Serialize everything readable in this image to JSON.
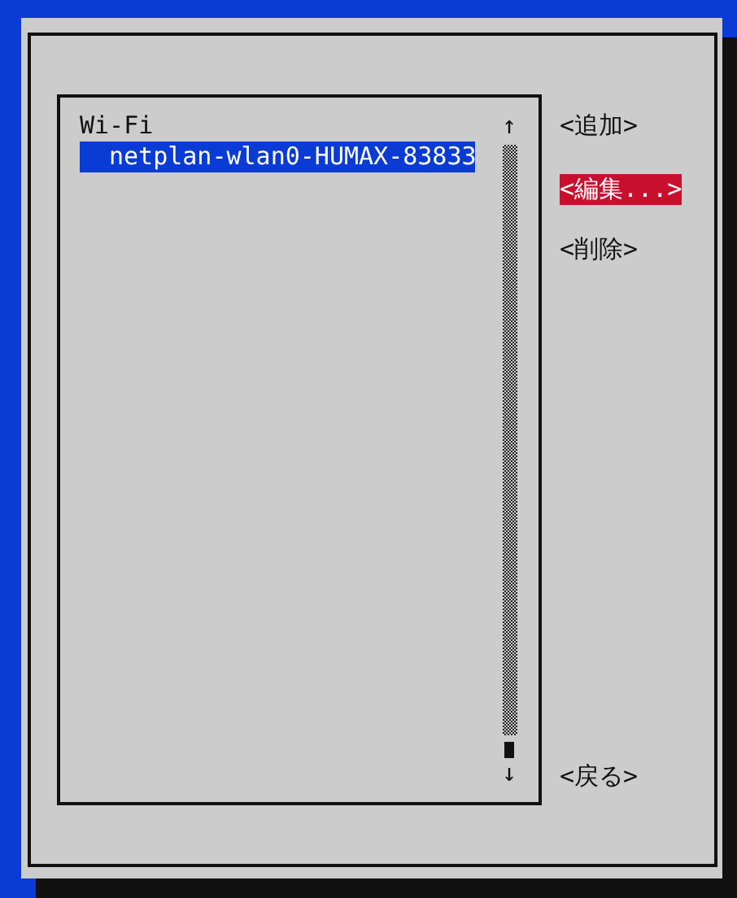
{
  "list": {
    "groups": [
      {
        "label": "Wi-Fi",
        "children": [
          {
            "label": "netplan-wlan0-HUMAX-83833",
            "selected": true
          }
        ]
      }
    ],
    "scroll_up": "↑",
    "scroll_down": "↓"
  },
  "buttons": [
    {
      "label": "<追加>",
      "selected": false
    },
    {
      "label": "<編集...>",
      "selected": true
    },
    {
      "label": "<削除>",
      "selected": false
    }
  ],
  "back_button": {
    "label": "<戻る>",
    "selected": false
  }
}
